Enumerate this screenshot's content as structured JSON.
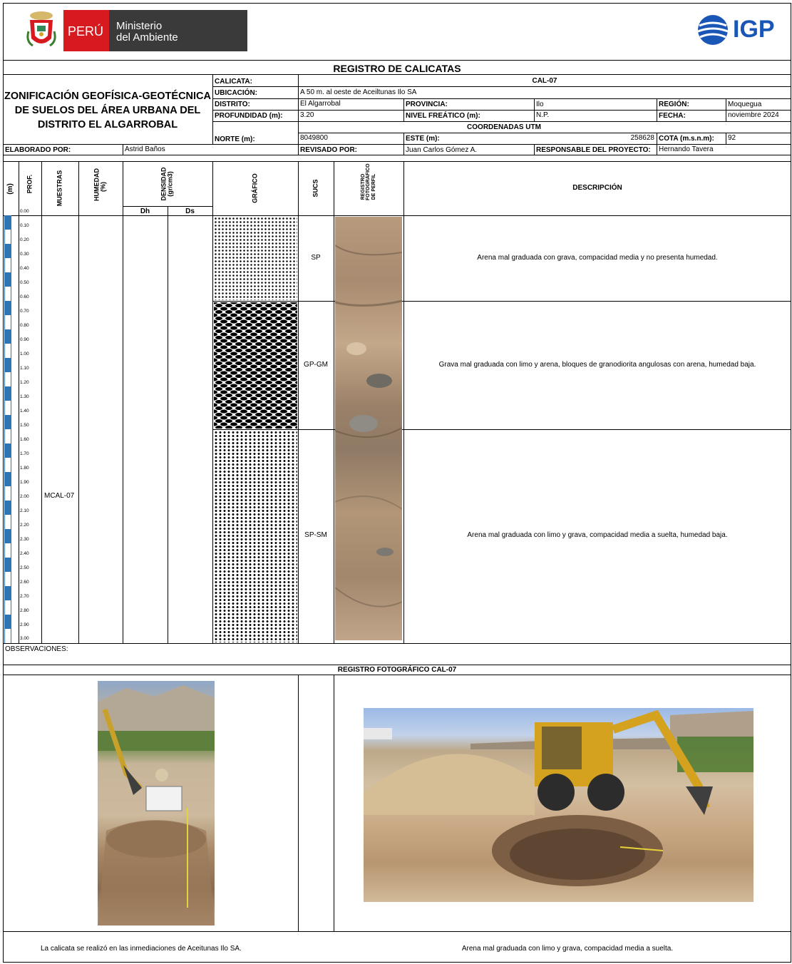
{
  "header": {
    "peru_label": "PERÚ",
    "ministry_line1": "Ministerio",
    "ministry_line2": "del Ambiente",
    "igp_label": "IGP",
    "report_title": "REGISTRO DE CALICATAS"
  },
  "project": {
    "title_line1": "ZONIFICACIÓN GEOFÍSICA-GEOTÉCNICA",
    "title_line2": "DE SUELOS DEL ÁREA URBANA DEL",
    "title_line3": "DISTRITO EL ALGARROBAL"
  },
  "fields": {
    "calicata_label": "CALICATA:",
    "calicata_value": "CAL-07",
    "ubicacion_label": "UBICACIÓN:",
    "ubicacion_value": "A 50 m. al oeste de Aceiltunas Ilo SA",
    "distrito_label": "DISTRITO:",
    "distrito_value": "El Algarrobal",
    "provincia_label": "PROVINCIA:",
    "provincia_value": "Ilo",
    "region_label": "REGIÓN:",
    "region_value": "Moquegua",
    "profundidad_label": "PROFUNDIDAD (m):",
    "profundidad_value": "3.20",
    "nivel_label": "NIVEL FREÁTICO (m):",
    "nivel_value": "N.P.",
    "fecha_label": "FECHA:",
    "fecha_value": "noviembre 2024",
    "coordenadas_label": "COORDENADAS UTM",
    "norte_label": "NORTE (m):",
    "norte_value": "8049800",
    "este_label": "ESTE (m):",
    "este_value": "258628",
    "cota_label": "COTA (m.s.n.m):",
    "cota_value": "92",
    "elaborado_label": "ELABORADO POR:",
    "elaborado_value": "Astrid Baños",
    "revisado_label": "REVISADO POR:",
    "revisado_value": "Juan Carlos Gómez A.",
    "responsable_label": "RESPONSABLE DEL PROYECTO:",
    "responsable_value": "Hernando Tavera"
  },
  "columns": {
    "m": "(m)",
    "prof": "PROF.",
    "muestras": "MUESTRAS",
    "humedad": "HUMEDAD (%)",
    "densidad": "DENSIDAD (gr/cm3)",
    "dh": "Dh",
    "ds": "Ds",
    "grafico": "GRÁFICO",
    "sucs": "SUCS",
    "registro_foto": "REGISTRO FOTOGRÁFICO DE PERFIL",
    "descripcion": "DESCRIPCIÓN"
  },
  "depth_ticks": [
    "0.00",
    "0.10",
    "0.20",
    "0.30",
    "0.40",
    "0.50",
    "0.60",
    "0.70",
    "0.80",
    "0.90",
    "1.00",
    "1.10",
    "1.20",
    "1.30",
    "1.40",
    "1.50",
    "1.60",
    "1.70",
    "1.80",
    "1.90",
    "2.00",
    "2.10",
    "2.20",
    "2.30",
    "2.40",
    "2.50",
    "2.60",
    "2.70",
    "2.80",
    "2.90",
    "3.00"
  ],
  "layers": [
    {
      "sucs": "SP",
      "description": "Arena mal graduada con grava, compacidad media y no presenta humedad."
    },
    {
      "sucs": "GP-GM",
      "description": "Grava mal graduada con limo y arena, bloques de granodiorita angulosas con arena, humedad baja."
    },
    {
      "sucs": "SP-SM",
      "description": "Arena mal graduada con limo y grava, compacidad media a suelta, humedad baja."
    }
  ],
  "sample_label": "MCAL-07",
  "observaciones_label": "OBSERVACIONES:",
  "photo_section_title": "REGISTRO FOTOGRÁFICO CAL-07",
  "captions": {
    "left": "La calicata se realizó en las inmediaciones de Aceitunas Ilo SA.",
    "right": "Arena mal graduada con limo y grava, compacidad media a suelta."
  },
  "colors": {
    "peru_red": "#d71920",
    "ministry_dark": "#3a3a3a",
    "igp_blue": "#1a56b5",
    "scale_blue": "#2e75b6"
  }
}
